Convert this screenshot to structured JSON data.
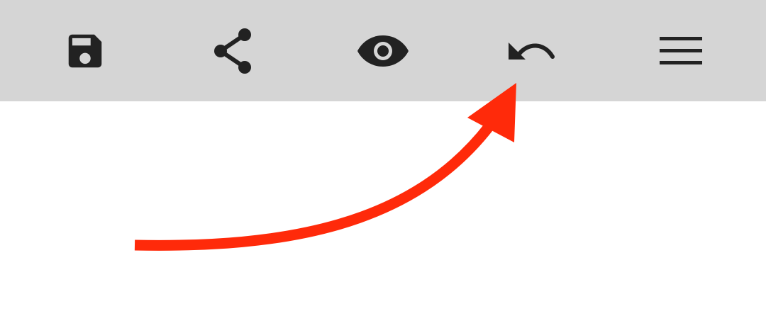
{
  "toolbar": {
    "background": "#d5d5d5",
    "icon_color": "#222222",
    "buttons": [
      {
        "id": "save",
        "icon": "floppy-disk-icon"
      },
      {
        "id": "share",
        "icon": "share-icon"
      },
      {
        "id": "preview",
        "icon": "eye-icon"
      },
      {
        "id": "undo",
        "icon": "undo-icon"
      },
      {
        "id": "menu",
        "icon": "hamburger-menu-icon"
      }
    ]
  },
  "annotation": {
    "type": "curved-arrow",
    "color": "#ff2a0a",
    "points_to": "undo-button"
  }
}
